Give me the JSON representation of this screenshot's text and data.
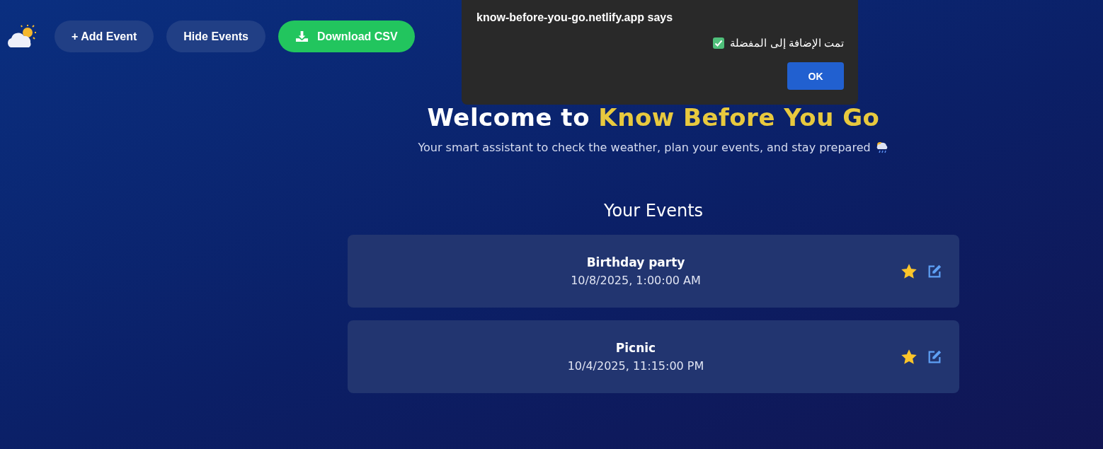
{
  "toolbar": {
    "buttons": [
      {
        "kind": "plain",
        "label": "+ Add Event"
      },
      {
        "kind": "plain",
        "label": "Hide Events"
      },
      {
        "kind": "download",
        "label": "Download CSV"
      }
    ]
  },
  "hero": {
    "title_start": "Welcome to",
    "title_highlight": "Know Before You Go",
    "subtitle": "Your smart assistant to check the weather, plan your events, and stay prepared"
  },
  "events": {
    "heading": "Your Events",
    "items": [
      {
        "name": "Birthday party",
        "date": "10/8/2025, 1:00:00 AM",
        "favorite": true
      },
      {
        "name": "Picnic",
        "date": "10/4/2025, 11:15:00 PM",
        "favorite": true
      }
    ]
  },
  "dialog": {
    "title": "know-before-you-go.netlify.app says",
    "message": "تمت الإضافة إلى المفضلة",
    "button": "OK"
  }
}
